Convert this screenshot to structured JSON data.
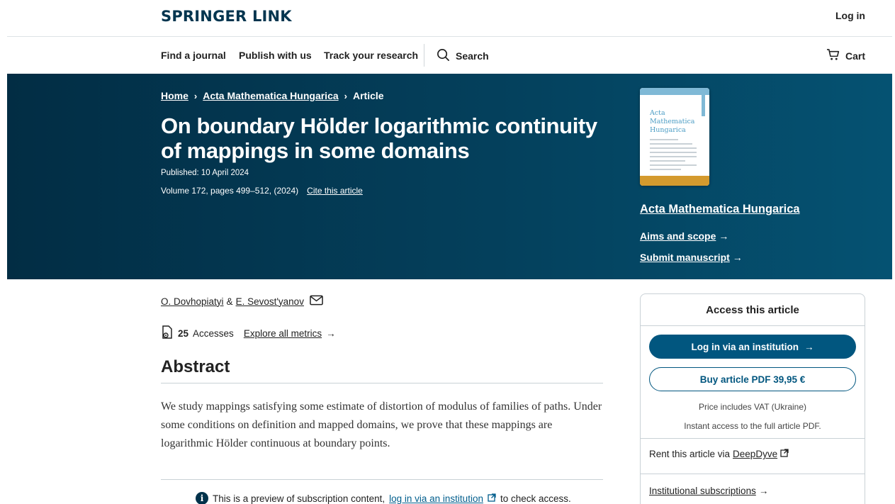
{
  "header": {
    "logo": "SPRINGER LINK",
    "login": "Log in"
  },
  "nav": {
    "find_journal": "Find a journal",
    "publish": "Publish with us",
    "track": "Track your research",
    "search": "Search",
    "cart": "Cart"
  },
  "breadcrumb": {
    "home": "Home",
    "journal": "Acta Mathematica Hungarica",
    "current": "Article",
    "separator": "›"
  },
  "article": {
    "title": "On boundary Hölder logarithmic continuity of mappings in some domains",
    "published": "Published: 10 April 2024",
    "volume": "Volume 172, pages 499–512, (2024)",
    "cite": "Cite this article",
    "authors": [
      "O. Dovhopiatyi",
      "E. Sevost'yanov"
    ],
    "author_joiner": "&",
    "accesses_count": "25",
    "accesses_label": "Accesses",
    "explore_metrics": "Explore all metrics",
    "abstract_heading": "Abstract",
    "abstract_text": "We study mappings satisfying some estimate of distortion of modulus of families of paths. Under some conditions on definition and mapped domains, we prove that these mappings are logarithmic Hölder continuous at boundary points.",
    "preview_prefix": "This is a preview of subscription content,",
    "preview_link": "log in via an institution",
    "preview_suffix": "to check access."
  },
  "journal_sidebar": {
    "cover_title": "Acta Mathematica Hungarica",
    "journal_name": "Acta Mathematica Hungarica",
    "aims": "Aims and scope",
    "submit": "Submit manuscript"
  },
  "access_panel": {
    "heading": "Access this article",
    "login_button": "Log in via an institution",
    "buy_button": "Buy article PDF 39,95 €",
    "vat_note": "Price includes VAT (Ukraine)",
    "instant_note": "Instant access to the full article PDF.",
    "rent_prefix": "Rent this article via",
    "rent_link": "DeepDyve",
    "institutional": "Institutional subscriptions"
  },
  "colors": {
    "brand_dark": "#02354f",
    "hero_bg": "#04405c",
    "primary_button": "#01567f",
    "link": "#025e8d"
  },
  "icons": [
    "search-icon",
    "cart-icon",
    "mail-icon",
    "accesses-icon",
    "arrow-right-icon",
    "info-icon",
    "external-link-icon"
  ]
}
